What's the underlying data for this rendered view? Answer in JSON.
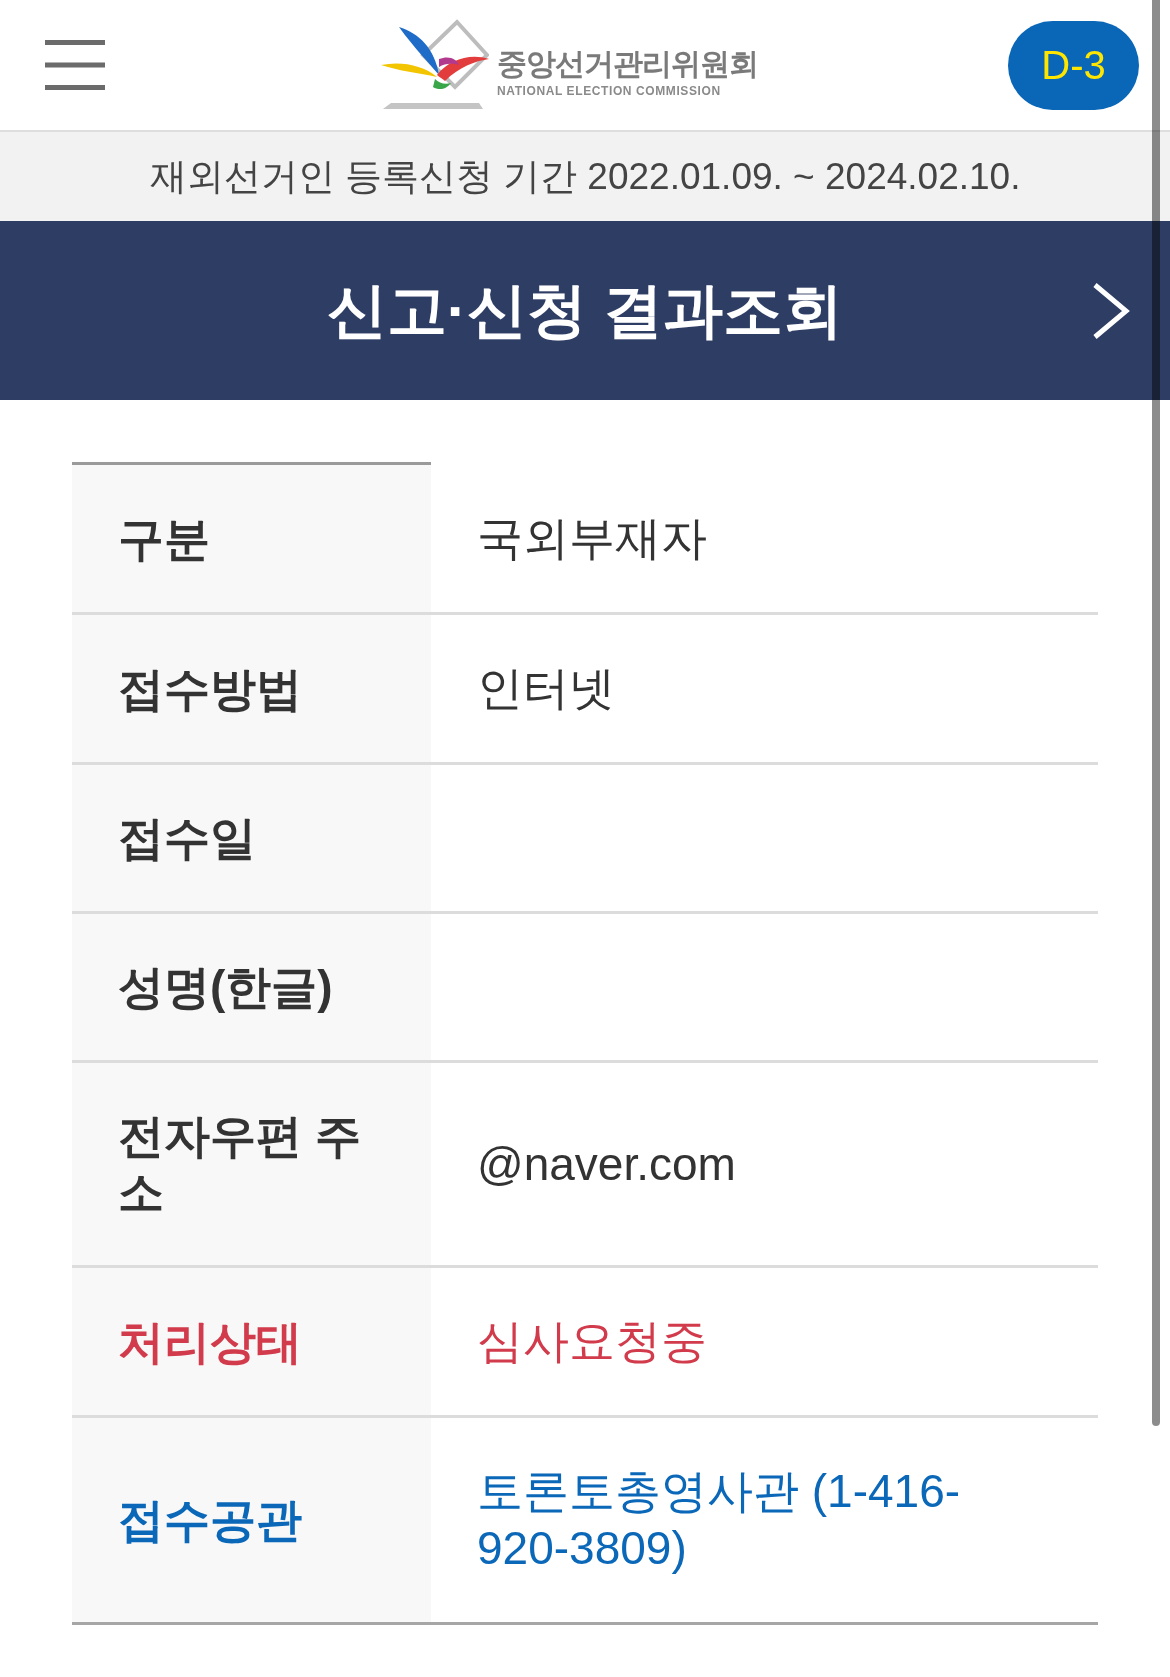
{
  "header": {
    "logo": {
      "name": "중앙선거관리위원회",
      "name_en": "NATIONAL ELECTION COMMISSION"
    },
    "countdown_badge": "D-3"
  },
  "notice": "재외선거인 등록신청 기간 2022.01.09. ~ 2024.02.10.",
  "banner": {
    "title": "신고·신청 결과조회"
  },
  "details": {
    "rows": [
      {
        "label": "구분",
        "value": "국외부재자",
        "color": "#333333"
      },
      {
        "label": "접수방법",
        "value": "인터넷",
        "color": "#333333"
      },
      {
        "label": "접수일",
        "color": "#333333"
      },
      {
        "label": "성명(한글)",
        "color": "#333333"
      },
      {
        "label": "전자우편 주소",
        "value": "@naver.com",
        "color": "#333333"
      },
      {
        "label": "처리상태",
        "value": "심사요청중",
        "color": "#d23b4b"
      },
      {
        "label": "접수공관",
        "value": "토론토총영사관 (1-416-920-3809)",
        "color": "#0b68b8"
      }
    ]
  }
}
